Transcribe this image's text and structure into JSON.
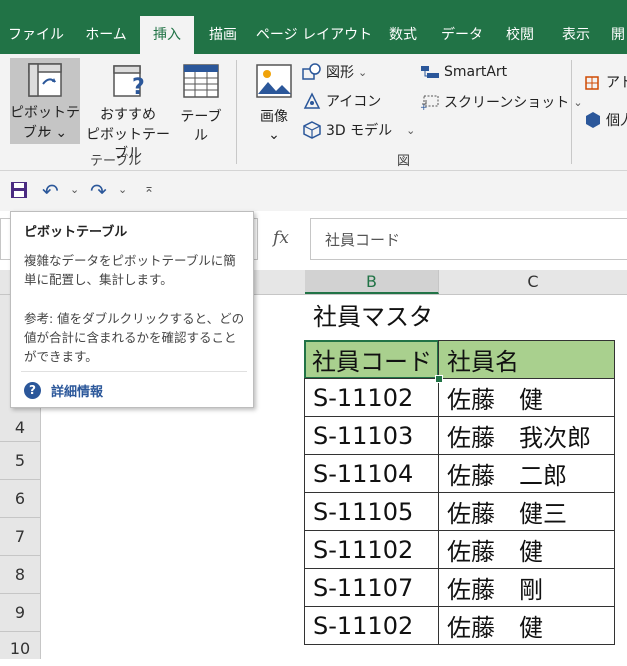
{
  "tabs": [
    "ファイル",
    "ホーム",
    "挿入",
    "描画",
    "ページ レイアウト",
    "数式",
    "データ",
    "校閲",
    "表示",
    "開"
  ],
  "active_tab": "挿入",
  "ribbon": {
    "tables_group": {
      "label": "テーブル",
      "pivot_line1": "ピボットテー",
      "pivot_line2": "ブル ⌄",
      "rec_line1": "おすすめ",
      "rec_line2": "ピボットテーブル",
      "table": "テーブル"
    },
    "illustrations_group": {
      "label": "図",
      "image_line1": "画像",
      "image_line2": "⌄",
      "shapes": "図形",
      "icons": "アイコン",
      "model3d": "3D モデル",
      "smartart": "SmartArt",
      "screenshot": "スクリーンショット"
    },
    "addins": {
      "addin": "アド",
      "personal": "個人"
    }
  },
  "formula_bar": {
    "fx": "fx",
    "content": "社員コード"
  },
  "columns": [
    "B",
    "C"
  ],
  "rows": [
    "4",
    "5",
    "6",
    "7",
    "8",
    "9",
    "10"
  ],
  "sheet": {
    "title": "社員マスタ",
    "headers": [
      "社員コード",
      "社員名"
    ],
    "records": [
      [
        "S-11102",
        "佐藤　健"
      ],
      [
        "S-11103",
        "佐藤　我次郎"
      ],
      [
        "S-11104",
        "佐藤　二郎"
      ],
      [
        "S-11105",
        "佐藤　健三"
      ],
      [
        "S-11102",
        "佐藤　健"
      ],
      [
        "S-11107",
        "佐藤　剛"
      ],
      [
        "S-11102",
        "佐藤　健"
      ]
    ]
  },
  "tooltip": {
    "title": "ピボットテーブル",
    "body1_line1": "複雑なデータをピボットテーブルに簡",
    "body1_line2": "単に配置し、集計します。",
    "body2_line1": "参考: 値をダブルクリックすると、どの",
    "body2_line2": "値が合計に含まれるかを確認すること",
    "body2_line3": "ができます。",
    "link": "詳細情報"
  },
  "colors": {
    "excel_green": "#217346",
    "header_fill": "#a9d08e",
    "ribbon_bg": "#f3f3f3",
    "link_blue": "#2b579a"
  }
}
